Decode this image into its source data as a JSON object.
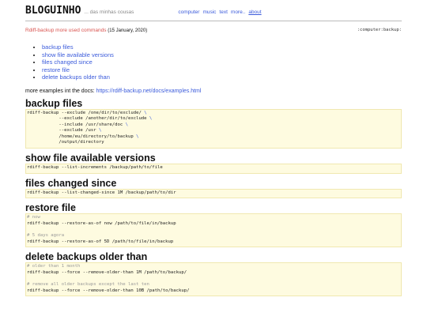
{
  "site": {
    "title": "BLOGUINHO",
    "tagline": "... das minhas cousas"
  },
  "nav": {
    "items": [
      "computer",
      "music",
      "text",
      "more..",
      "about"
    ]
  },
  "post": {
    "title": "Rdiff-backup more used commands",
    "date": "(15 January, 2020)",
    "path": ":computer:backup:"
  },
  "toc": [
    "backup files",
    "show file available versions",
    "files changed since",
    "restore file",
    "delete backups older than"
  ],
  "more": {
    "prefix": "more examples int the docs: ",
    "link": "https://rdiff-backup.net/docs/examples.html"
  },
  "sections": [
    {
      "heading": "backup files",
      "lines": [
        {
          "text": "rdiff-backup --exclude /one/dir/to/exclude/ ",
          "bs": "\\"
        },
        {
          "text": "            --exclude /another/dir/to/exclude ",
          "bs": "\\"
        },
        {
          "text": "            --include /usr/share/doc ",
          "bs": "\\"
        },
        {
          "text": "            --exclude /usr ",
          "bs": "\\"
        },
        {
          "text": "            /home/eu/directory/to/backup ",
          "bs": "\\"
        },
        {
          "text": "            /output/directory"
        }
      ]
    },
    {
      "heading": "show file available versions",
      "lines": [
        {
          "text": "rdiff-backup --list-increments /backup/path/to/file"
        }
      ]
    },
    {
      "heading": "files changed since",
      "lines": [
        {
          "text": "rdiff-backup --list-changed-since 1M /backup/path/to/dir"
        }
      ]
    },
    {
      "heading": "restore file",
      "lines": [
        {
          "text": "# now",
          "comment": true
        },
        {
          "text": "rdiff-backup --restore-as-of now /path/to/file/in/backup"
        },
        {
          "text": ""
        },
        {
          "text": "# 5 days agora",
          "comment": true
        },
        {
          "text": "rdiff-backup --restore-as-of 5D /path/to/file/in/backup"
        }
      ]
    },
    {
      "heading": "delete backups older than",
      "lines": [
        {
          "text": "# older than 1 month",
          "comment": true
        },
        {
          "text": "rdiff-backup --force --remove-older-than 1M /path/to/backup/"
        },
        {
          "text": ""
        },
        {
          "text": "# remove all older backups except the last ten",
          "comment": true
        },
        {
          "text": "rdiff-backup --force --remove-older-than 10B /path/to/backup/"
        }
      ]
    }
  ]
}
